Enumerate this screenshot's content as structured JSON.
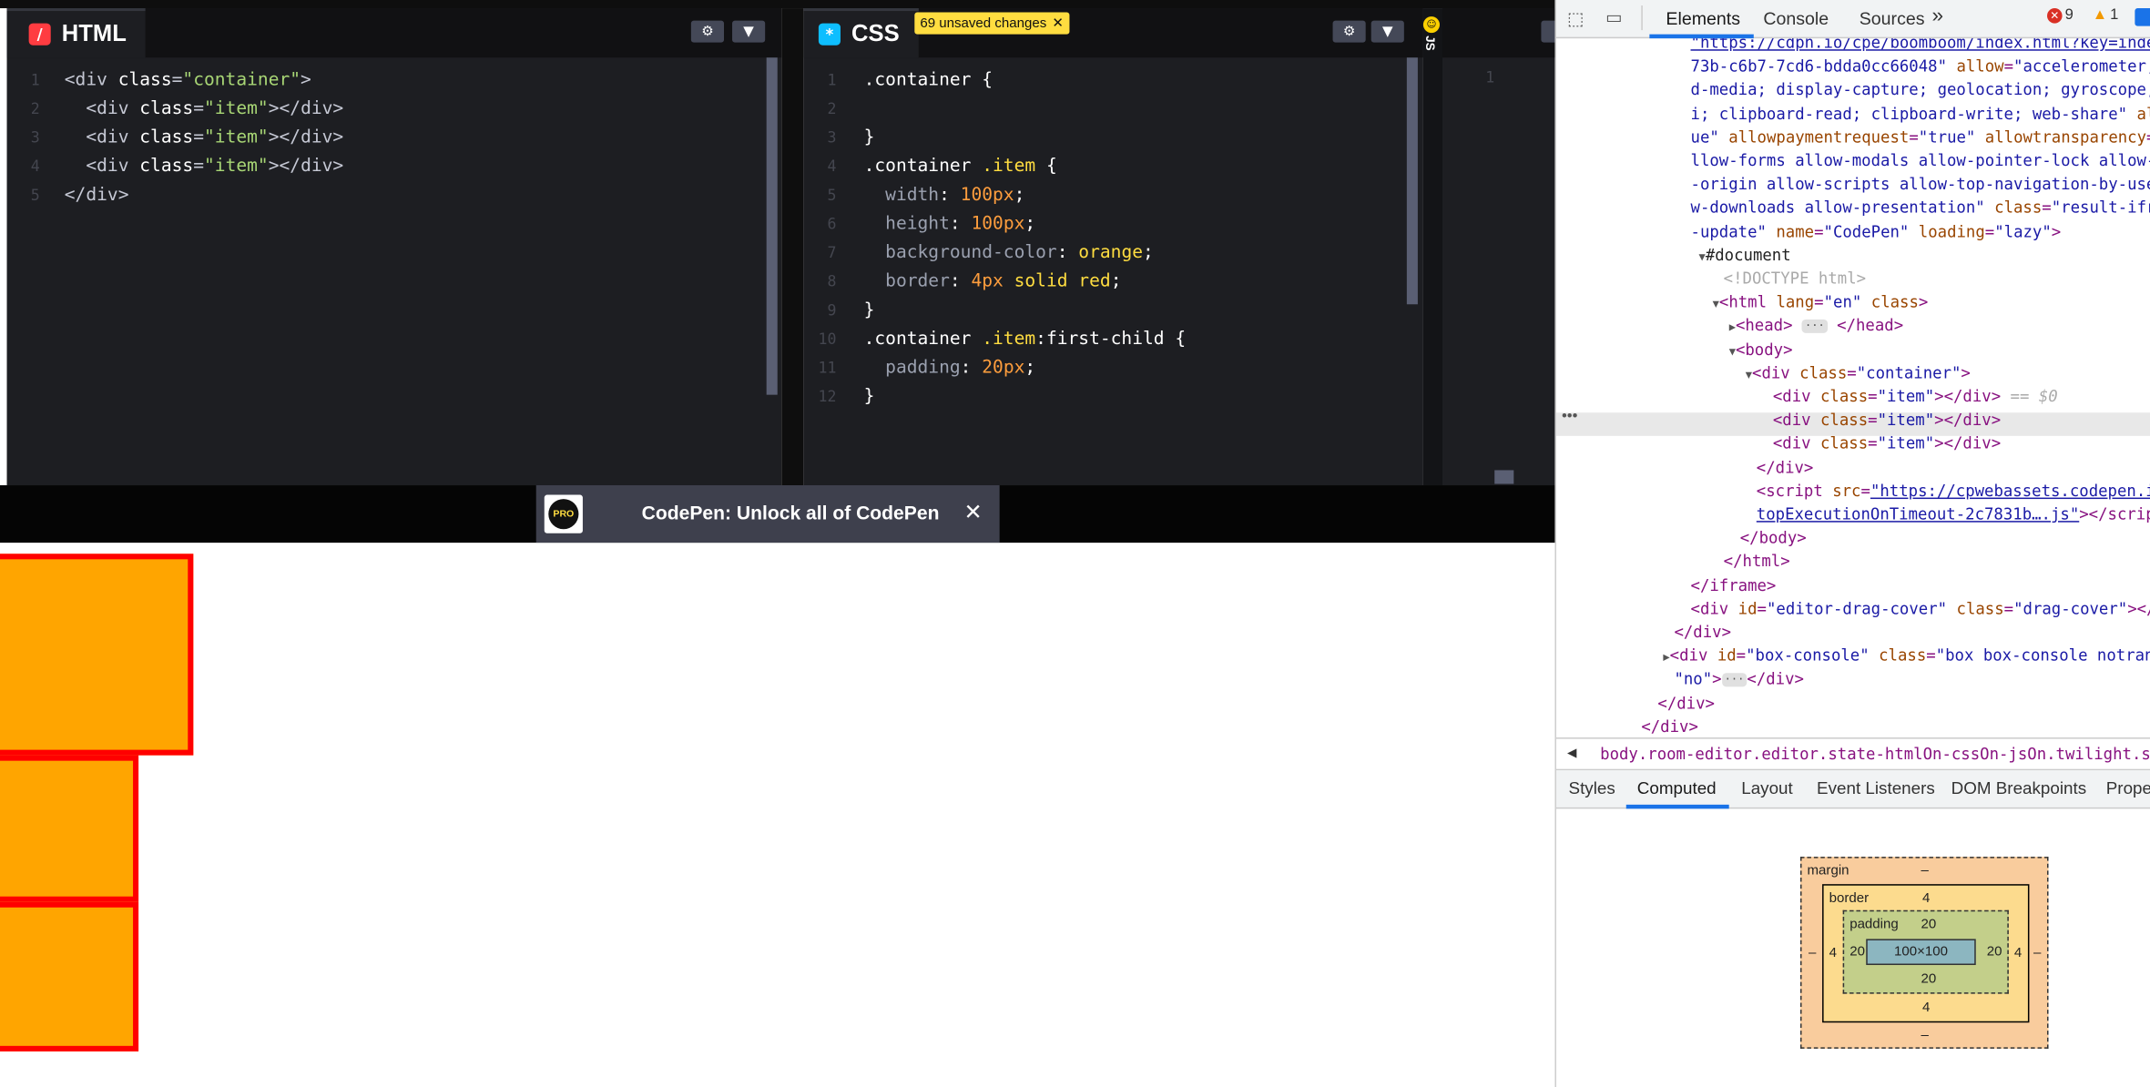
{
  "html_panel": {
    "title": "HTML",
    "icon": "html-icon",
    "lines": [
      {
        "n": "1",
        "tokens": [
          {
            "c": "t-tag",
            "t": "<div "
          },
          {
            "c": "t-attr",
            "t": "class"
          },
          {
            "c": "t-tag",
            "t": "="
          },
          {
            "c": "t-str",
            "t": "\"container\""
          },
          {
            "c": "t-tag",
            "t": ">"
          }
        ]
      },
      {
        "n": "2",
        "tokens": [
          {
            "c": "t-tag",
            "t": "  <div "
          },
          {
            "c": "t-attr",
            "t": "class"
          },
          {
            "c": "t-tag",
            "t": "="
          },
          {
            "c": "t-str",
            "t": "\"item\""
          },
          {
            "c": "t-tag",
            "t": "></div>"
          }
        ]
      },
      {
        "n": "3",
        "tokens": [
          {
            "c": "t-tag",
            "t": "  <div "
          },
          {
            "c": "t-attr",
            "t": "class"
          },
          {
            "c": "t-tag",
            "t": "="
          },
          {
            "c": "t-str",
            "t": "\"item\""
          },
          {
            "c": "t-tag",
            "t": "></div>"
          }
        ]
      },
      {
        "n": "4",
        "tokens": [
          {
            "c": "t-tag",
            "t": "  <div "
          },
          {
            "c": "t-attr",
            "t": "class"
          },
          {
            "c": "t-tag",
            "t": "="
          },
          {
            "c": "t-str",
            "t": "\"item\""
          },
          {
            "c": "t-tag",
            "t": "></div>"
          }
        ]
      },
      {
        "n": "5",
        "tokens": [
          {
            "c": "t-tag",
            "t": "</div>"
          }
        ]
      }
    ]
  },
  "css_panel": {
    "title": "CSS",
    "icon": "css-icon",
    "unsaved": "69 unsaved changes",
    "lines": [
      {
        "n": "1",
        "tokens": [
          {
            "c": "t-sel",
            "t": ".container {"
          }
        ]
      },
      {
        "n": "2",
        "tokens": []
      },
      {
        "n": "3",
        "tokens": [
          {
            "c": "t-sel",
            "t": "}"
          }
        ]
      },
      {
        "n": "4",
        "tokens": [
          {
            "c": "t-sel",
            "t": ".container "
          },
          {
            "c": "t-val",
            "t": ".item"
          },
          {
            "c": "t-sel",
            "t": " {"
          }
        ]
      },
      {
        "n": "5",
        "tokens": [
          {
            "c": "t-prop",
            "t": "  width"
          },
          {
            "c": "t-plain",
            "t": ": "
          },
          {
            "c": "t-num",
            "t": "100px"
          },
          {
            "c": "t-plain",
            "t": ";"
          }
        ]
      },
      {
        "n": "6",
        "tokens": [
          {
            "c": "t-prop",
            "t": "  height"
          },
          {
            "c": "t-plain",
            "t": ": "
          },
          {
            "c": "t-num",
            "t": "100px"
          },
          {
            "c": "t-plain",
            "t": ";"
          }
        ]
      },
      {
        "n": "7",
        "tokens": [
          {
            "c": "t-prop",
            "t": "  background-color"
          },
          {
            "c": "t-plain",
            "t": ": "
          },
          {
            "c": "t-val",
            "t": "orange"
          },
          {
            "c": "t-plain",
            "t": ";"
          }
        ]
      },
      {
        "n": "8",
        "tokens": [
          {
            "c": "t-prop",
            "t": "  border"
          },
          {
            "c": "t-plain",
            "t": ": "
          },
          {
            "c": "t-num",
            "t": "4px"
          },
          {
            "c": "t-val",
            "t": " solid red"
          },
          {
            "c": "t-plain",
            "t": ";"
          }
        ]
      },
      {
        "n": "9",
        "tokens": [
          {
            "c": "t-sel",
            "t": "}"
          }
        ]
      },
      {
        "n": "10",
        "tokens": [
          {
            "c": "t-sel",
            "t": ".container "
          },
          {
            "c": "t-val",
            "t": ".item"
          },
          {
            "c": "t-sel",
            "t": ":first-child {"
          }
        ]
      },
      {
        "n": "11",
        "tokens": [
          {
            "c": "t-prop",
            "t": "  padding"
          },
          {
            "c": "t-plain",
            "t": ": "
          },
          {
            "c": "t-num",
            "t": "20px"
          },
          {
            "c": "t-plain",
            "t": ";"
          }
        ]
      },
      {
        "n": "12",
        "tokens": [
          {
            "c": "t-sel",
            "t": "}"
          }
        ]
      }
    ]
  },
  "js_panel": {
    "title": "JS",
    "line": "1"
  },
  "promo": {
    "text": "CodePen: Unlock all of CodePen",
    "logo": "PRO",
    "close": "✕"
  },
  "colors": {
    "item_fill": "#ffa500",
    "item_border": "#ff0000",
    "unsaved_bg": "#ffdd40",
    "devtools_accent": "#1a73e8"
  },
  "devtools": {
    "tabs": [
      "Elements",
      "Console",
      "Sources"
    ],
    "more": "»",
    "errors": "9",
    "warnings": "1",
    "breadcrumb": "body.room-editor.editor.state-htmlOn-cssOn-jsOn.twilight.sidebar-false.layo",
    "sub_tabs": [
      "Styles",
      "Computed",
      "Layout",
      "Event Listeners",
      "DOM Breakpoints",
      "Prope"
    ],
    "box_model": {
      "margin_label": "margin",
      "margin": "–",
      "border_label": "border",
      "border": "4",
      "padding_label": "padding",
      "padding": "20",
      "content": "100×100",
      "margin_side": "–",
      "border_side": "4",
      "padding_side": "20"
    },
    "selected_marker": "== $0"
  }
}
